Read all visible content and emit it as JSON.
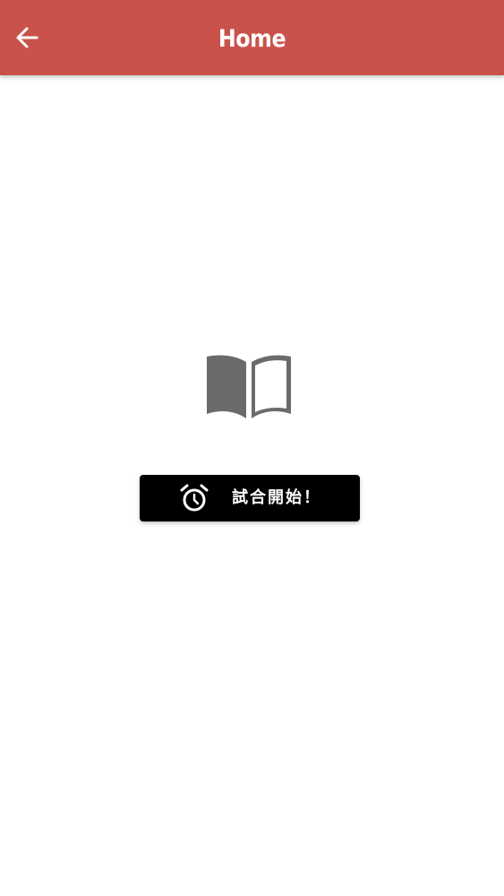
{
  "app_bar": {
    "title": "Home",
    "back_icon": "arrow-left-icon",
    "background_color": "#c9534b"
  },
  "content": {
    "illustration_icon": "open-book-icon",
    "icon_color": "#6b6b6b",
    "start_button": {
      "label": "試合開始！",
      "icon": "alarm-clock-icon",
      "background_color": "#000000"
    }
  }
}
